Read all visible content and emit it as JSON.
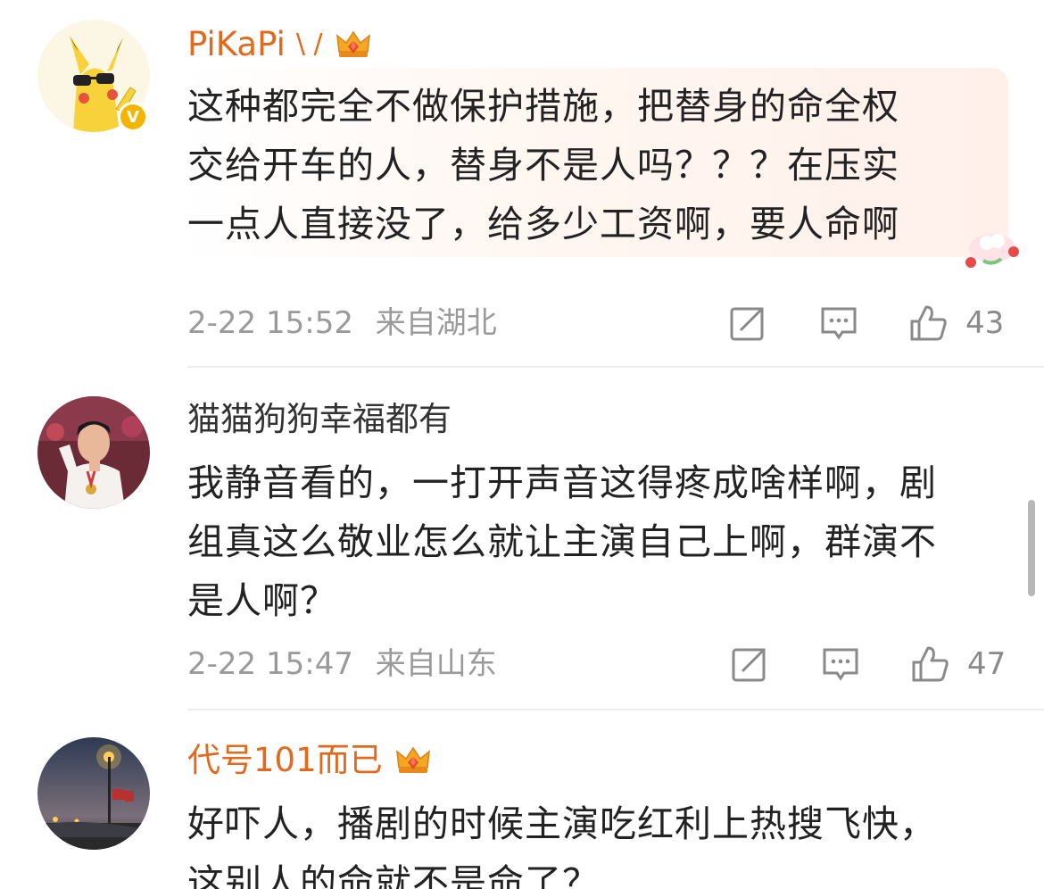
{
  "comments": [
    {
      "user": "PiKaPi",
      "user_suffix": "\\ /",
      "text_lines": [
        "这种都完全不做保护措施，把替身的命全权",
        "交给开车的人，替身不是人吗？？？在压实",
        "一点人直接没了，给多少工资啊，要人命啊"
      ],
      "time": "2-22 15:52",
      "location": "来自湖北",
      "likes": "43"
    },
    {
      "user": "猫猫狗狗幸福都有",
      "text_lines": [
        "我静音看的，一打开声音这得疼成啥样啊，剧",
        "组真这么敬业怎么就让主演自己上啊，群演不",
        "是人啊？"
      ],
      "time": "2-22 15:47",
      "location": "来自山东",
      "likes": "47"
    },
    {
      "user": "代号101而已",
      "text_lines": [
        "好吓人，播剧的时候主演吃红利上热搜飞快，",
        "这别人的命就不是命了？"
      ]
    }
  ],
  "icons": {
    "verified": "V",
    "repost": "repost-icon",
    "comment": "comment-icon",
    "like": "thumbs-up-icon",
    "crown": "crown-icon"
  },
  "colors": {
    "vip_name": "#e26a1f",
    "plain_name": "#333333",
    "meta": "#9a9a9a",
    "verified_badge": "#f5b400"
  }
}
